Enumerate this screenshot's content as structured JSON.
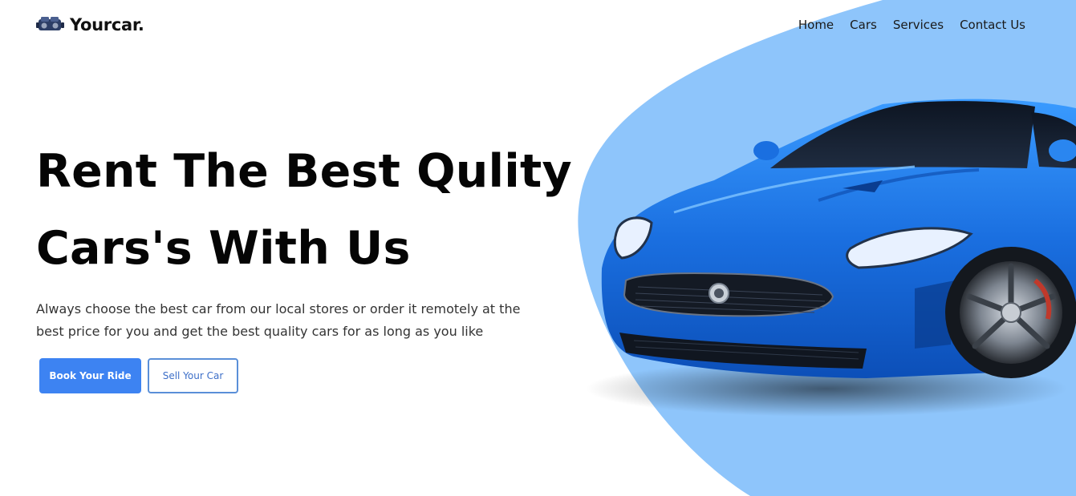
{
  "brand": {
    "name": "Yourcar.",
    "logo_icon": "car-engine-icon"
  },
  "nav": {
    "items": [
      {
        "label": "Home"
      },
      {
        "label": "Cars"
      },
      {
        "label": "Services"
      },
      {
        "label": "Contact Us"
      }
    ]
  },
  "hero": {
    "title_line1": "Rent The Best Qulity",
    "title_line2": "Cars's With Us",
    "description": "Always choose the best car from our local stores or order it remotely at the best price for you and get the best quality cars for as long as you like",
    "primary_button": "Book Your Ride",
    "secondary_button": "Sell Your Car",
    "image": "blue-sports-car-image"
  },
  "colors": {
    "accent": "#3d83f2",
    "blob": "#8ec5fb",
    "car_body": "#1f6fe0"
  }
}
